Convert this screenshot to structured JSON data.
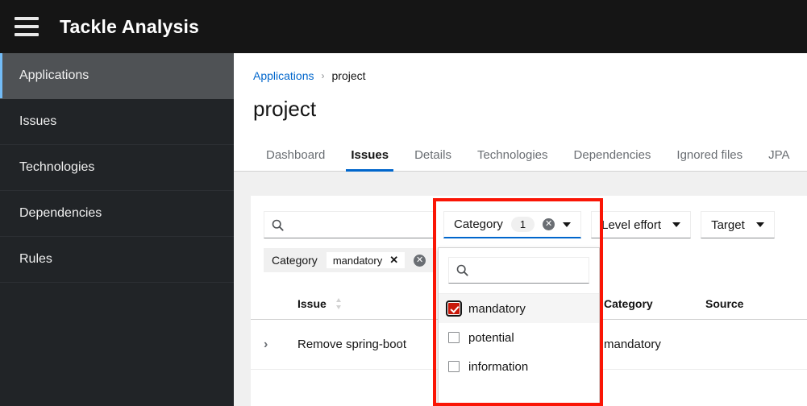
{
  "masthead": {
    "menu_icon": "hamburger-icon",
    "title": "Tackle Analysis"
  },
  "sidebar": {
    "items": [
      {
        "label": "Applications",
        "active": true
      },
      {
        "label": "Issues",
        "active": false
      },
      {
        "label": "Technologies",
        "active": false
      },
      {
        "label": "Dependencies",
        "active": false
      },
      {
        "label": "Rules",
        "active": false
      }
    ]
  },
  "breadcrumb": {
    "root": "Applications",
    "separator": "›",
    "current": "project"
  },
  "page": {
    "title": "project"
  },
  "tabs": [
    {
      "label": "Dashboard",
      "active": false
    },
    {
      "label": "Issues",
      "active": true
    },
    {
      "label": "Details",
      "active": false
    },
    {
      "label": "Technologies",
      "active": false
    },
    {
      "label": "Dependencies",
      "active": false
    },
    {
      "label": "Ignored files",
      "active": false
    },
    {
      "label": "JPA",
      "active": false
    }
  ],
  "toolbar": {
    "search": {
      "value": "",
      "placeholder": "",
      "icon": "search-icon"
    },
    "category_filter": {
      "label": "Category",
      "count": "1",
      "clear_icon": "clear-circle-icon",
      "caret_icon": "chevron-down-icon",
      "expanded": true
    },
    "level_effort_filter": {
      "label": "Level effort",
      "caret_icon": "chevron-down-icon"
    },
    "target_filter": {
      "label": "Target",
      "caret_icon": "chevron-down-icon"
    }
  },
  "dropdown": {
    "search": {
      "value": "",
      "placeholder": "",
      "icon": "search-icon"
    },
    "options": [
      {
        "label": "mandatory",
        "checked": true
      },
      {
        "label": "potential",
        "checked": false
      },
      {
        "label": "information",
        "checked": false
      }
    ]
  },
  "applied_filters": {
    "group_label": "Category",
    "chips": [
      {
        "label": "mandatory",
        "remove_icon": "✕"
      }
    ],
    "clear_all_icon": "clear-circle-icon"
  },
  "table": {
    "columns": [
      {
        "key": "issue",
        "label": "Issue",
        "sortable": true
      },
      {
        "key": "category",
        "label": "Category",
        "sortable": false
      },
      {
        "key": "source",
        "label": "Source",
        "sortable": false
      }
    ],
    "rows": [
      {
        "expand_icon": "chevron-right-icon",
        "issue": "Remove spring-boot",
        "category": "mandatory",
        "source": ""
      }
    ]
  },
  "annotation": {
    "color": "#fa1505",
    "target": "category-filter-dropdown"
  }
}
